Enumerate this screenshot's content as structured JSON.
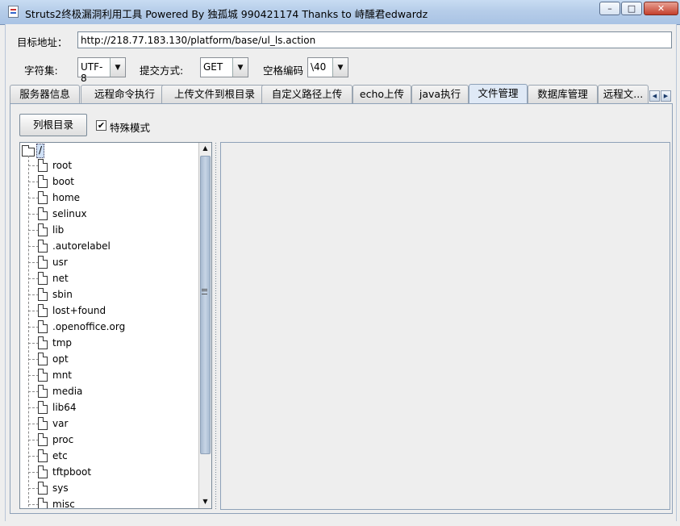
{
  "window": {
    "title": "Struts2终极漏洞利用工具   Powered By 独孤城 990421174 Thanks to 峙醺君edwardz",
    "minimize": "–",
    "maximize": "□",
    "close": "✕"
  },
  "form": {
    "url_label": "目标地址：",
    "url_value": "http://218.77.183.130/platform/base/ul_ls.action",
    "charset_label": "字符集:",
    "charset_value": "UTF-8",
    "method_label": "提交方式:",
    "method_value": "GET",
    "space_label": "空格编码",
    "space_value": "\\40",
    "arrow": "▼"
  },
  "tabs": [
    {
      "label": "服务器信息",
      "active": false
    },
    {
      "label": "远程命令执行",
      "active": false
    },
    {
      "label": "上传文件到根目录",
      "active": false
    },
    {
      "label": "自定义路径上传",
      "active": false
    },
    {
      "label": "echo上传",
      "active": false
    },
    {
      "label": "java执行",
      "active": false
    },
    {
      "label": "文件管理",
      "active": true
    },
    {
      "label": "数据库管理",
      "active": false
    },
    {
      "label": "远程文...",
      "active": false
    }
  ],
  "tab_scroll": {
    "left": "◀",
    "right": "▶"
  },
  "file_manager": {
    "list_root_button": "列根目录",
    "special_mode_label": "特殊模式",
    "special_mode_checked": "✔",
    "tree_root": "/",
    "tree_items": [
      "root",
      "boot",
      "home",
      "selinux",
      "lib",
      ".autorelabel",
      "usr",
      "net",
      "sbin",
      "lost+found",
      ".openoffice.org",
      "tmp",
      "opt",
      "mnt",
      "media",
      "lib64",
      "var",
      "proc",
      "etc",
      "tftpboot",
      "sys",
      "misc"
    ],
    "scroll_up": "▲",
    "scroll_down": "▼"
  }
}
